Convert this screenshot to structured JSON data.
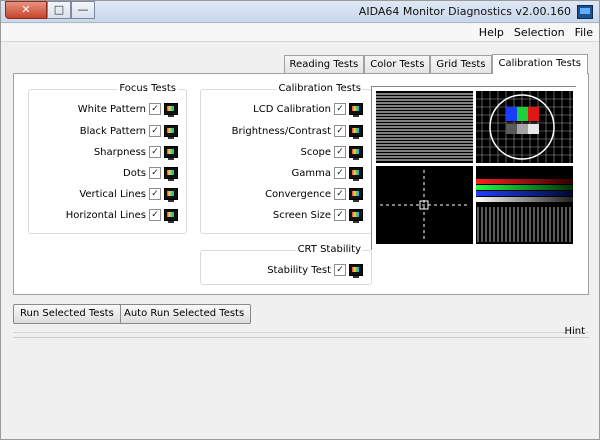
{
  "window": {
    "title": "AIDA64 Monitor Diagnostics v2.00.160",
    "controls": {
      "minimize": "—",
      "maximize": "□",
      "close": "✕"
    }
  },
  "menu": {
    "items": [
      "File",
      "Selection",
      "Help"
    ]
  },
  "tabs": [
    {
      "label": "Calibration Tests",
      "active": true
    },
    {
      "label": "Grid Tests",
      "active": false
    },
    {
      "label": "Color Tests",
      "active": false
    },
    {
      "label": "Reading Tests",
      "active": false
    }
  ],
  "calibration_group": {
    "title": "Calibration Tests",
    "items": [
      {
        "label": "LCD Calibration",
        "checked": true
      },
      {
        "label": "Brightness/Contrast",
        "checked": true
      },
      {
        "label": "Scope",
        "checked": true
      },
      {
        "label": "Gamma",
        "checked": true
      },
      {
        "label": "Convergence",
        "checked": true
      },
      {
        "label": "Screen Size",
        "checked": true
      }
    ]
  },
  "focus_group": {
    "title": "Focus Tests",
    "items": [
      {
        "label": "White Pattern",
        "checked": true
      },
      {
        "label": "Black Pattern",
        "checked": true
      },
      {
        "label": "Sharpness",
        "checked": true
      },
      {
        "label": "Dots",
        "checked": true
      },
      {
        "label": "Vertical Lines",
        "checked": true
      },
      {
        "label": "Horizontal Lines",
        "checked": true
      }
    ]
  },
  "crt_group": {
    "title": "CRT Stability",
    "items": [
      {
        "label": "Stability Test",
        "checked": true
      }
    ]
  },
  "buttons": {
    "auto_run": "Auto Run Selected Tests",
    "run": "Run Selected Tests"
  },
  "hint": {
    "label": "Hint"
  }
}
